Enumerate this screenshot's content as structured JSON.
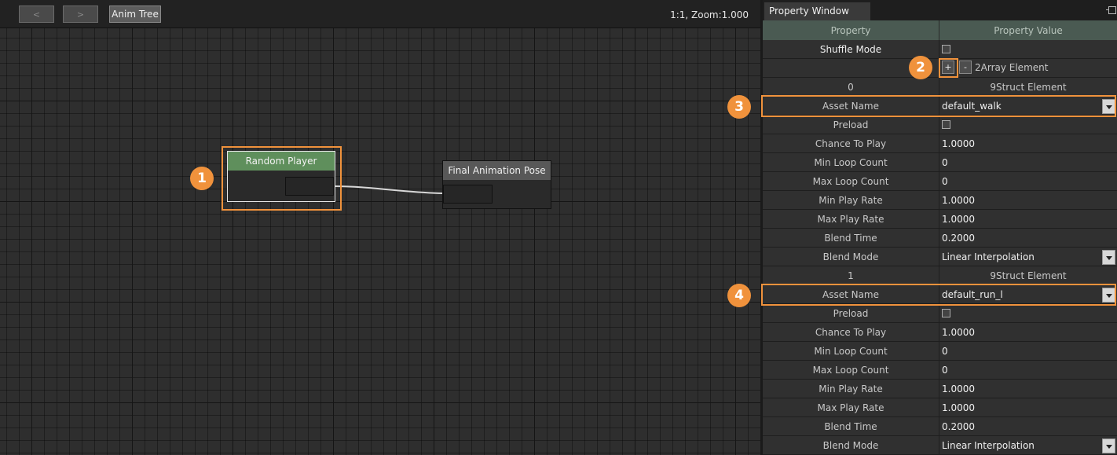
{
  "toolbar": {
    "back_label": "<",
    "forward_label": ">",
    "anim_tree_label": "Anim Tree",
    "zoom_status": "1:1, Zoom:1.000"
  },
  "graph": {
    "nodes": [
      {
        "title": "Random Player"
      },
      {
        "title": "Final Animation Pose"
      }
    ]
  },
  "panel": {
    "tab_title": "Property Window",
    "header": {
      "property": "Property",
      "value": "Property Value"
    },
    "shuffle_mode": {
      "label": "Shuffle Mode",
      "checked": false
    },
    "array": {
      "add_label": "+",
      "remove_label": "-",
      "label": "2Array Element"
    },
    "elements": [
      {
        "index": "0",
        "struct_label": "9Struct Element",
        "fields": [
          {
            "key": "Asset Name",
            "value": "default_walk",
            "type": "dropdown"
          },
          {
            "key": "Preload",
            "value": "",
            "type": "checkbox"
          },
          {
            "key": "Chance To Play",
            "value": "1.0000",
            "type": "text"
          },
          {
            "key": "Min Loop Count",
            "value": "0",
            "type": "text"
          },
          {
            "key": "Max Loop Count",
            "value": "0",
            "type": "text"
          },
          {
            "key": "Min Play Rate",
            "value": "1.0000",
            "type": "text"
          },
          {
            "key": "Max Play Rate",
            "value": "1.0000",
            "type": "text"
          },
          {
            "key": "Blend Time",
            "value": "0.2000",
            "type": "text"
          },
          {
            "key": "Blend Mode",
            "value": "Linear Interpolation",
            "type": "dropdown"
          }
        ]
      },
      {
        "index": "1",
        "struct_label": "9Struct Element",
        "fields": [
          {
            "key": "Asset Name",
            "value": "default_run_l",
            "type": "dropdown"
          },
          {
            "key": "Preload",
            "value": "",
            "type": "checkbox"
          },
          {
            "key": "Chance To Play",
            "value": "1.0000",
            "type": "text"
          },
          {
            "key": "Min Loop Count",
            "value": "0",
            "type": "text"
          },
          {
            "key": "Max Loop Count",
            "value": "0",
            "type": "text"
          },
          {
            "key": "Min Play Rate",
            "value": "1.0000",
            "type": "text"
          },
          {
            "key": "Max Play Rate",
            "value": "1.0000",
            "type": "text"
          },
          {
            "key": "Blend Time",
            "value": "0.2000",
            "type": "text"
          },
          {
            "key": "Blend Mode",
            "value": "Linear Interpolation",
            "type": "dropdown"
          }
        ]
      }
    ]
  },
  "annotations": [
    "1",
    "2",
    "3",
    "4"
  ],
  "colors": {
    "accent": "#f0923c",
    "node_header": "#5f8f5c",
    "panel_header": "#4a5a52"
  }
}
